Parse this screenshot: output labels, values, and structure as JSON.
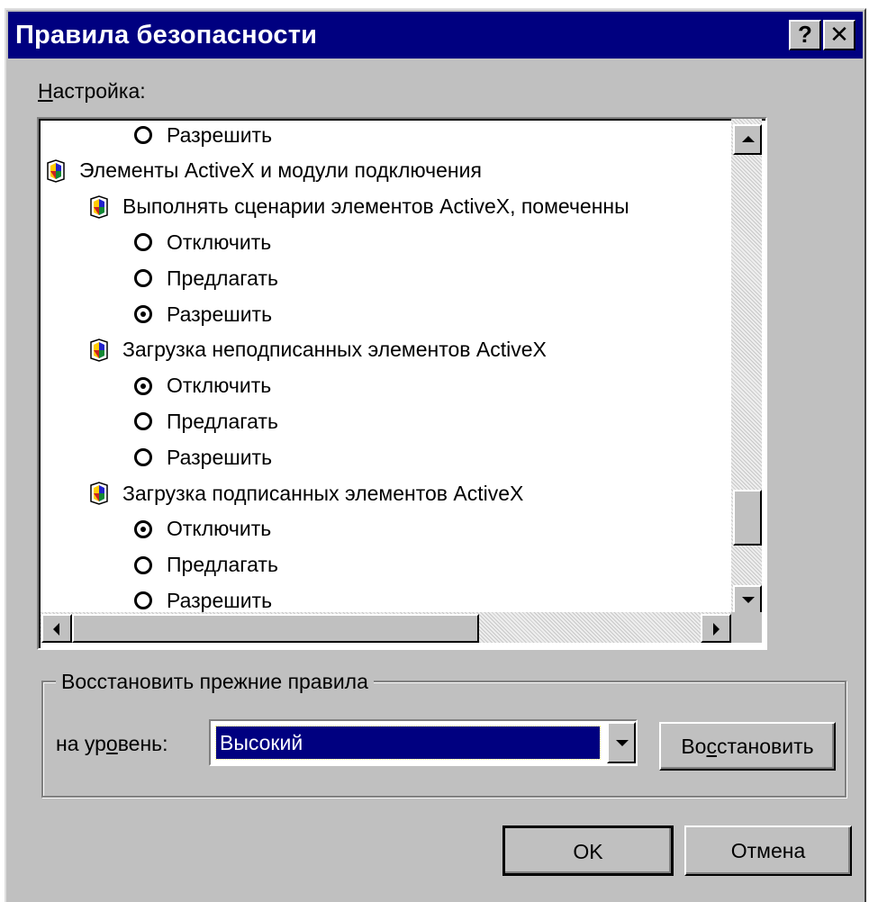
{
  "window": {
    "title": "Правила безопасности",
    "help_label": "?",
    "close_label": "✕"
  },
  "settings": {
    "label_hotkey": "Н",
    "label_rest": "астройка:",
    "tree": [
      {
        "kind": "option",
        "indent": 2,
        "checked": false,
        "text": "Разрешить"
      },
      {
        "kind": "category",
        "indent": 0,
        "text": "Элементы ActiveX и модули подключения"
      },
      {
        "kind": "category",
        "indent": 1,
        "text": "Выполнять сценарии элементов ActiveX, помеченны"
      },
      {
        "kind": "option",
        "indent": 2,
        "checked": false,
        "text": "Отключить"
      },
      {
        "kind": "option",
        "indent": 2,
        "checked": false,
        "text": "Предлагать"
      },
      {
        "kind": "option",
        "indent": 2,
        "checked": true,
        "text": "Разрешить"
      },
      {
        "kind": "category",
        "indent": 1,
        "text": "Загрузка неподписанных элементов ActiveX"
      },
      {
        "kind": "option",
        "indent": 2,
        "checked": true,
        "text": "Отключить"
      },
      {
        "kind": "option",
        "indent": 2,
        "checked": false,
        "text": "Предлагать"
      },
      {
        "kind": "option",
        "indent": 2,
        "checked": false,
        "text": "Разрешить"
      },
      {
        "kind": "category",
        "indent": 1,
        "text": "Загрузка подписанных элементов ActiveX"
      },
      {
        "kind": "option",
        "indent": 2,
        "checked": true,
        "text": "Отключить"
      },
      {
        "kind": "option",
        "indent": 2,
        "checked": false,
        "text": "Предлагать"
      },
      {
        "kind": "option",
        "indent": 2,
        "checked": false,
        "text": "Разрешить"
      }
    ]
  },
  "reset": {
    "group_title": "Восстановить прежние правила",
    "level_label_pre": "на ур",
    "level_label_hotkey": "о",
    "level_label_post": "вень:",
    "level_value": "Высокий",
    "restore_pre": "Во",
    "restore_hotkey": "с",
    "restore_post": "становить"
  },
  "buttons": {
    "ok": "OK",
    "cancel": "Отмена"
  },
  "colors": {
    "titlebar": "#000080",
    "face": "#c0c0c0",
    "selection": "#000080"
  }
}
